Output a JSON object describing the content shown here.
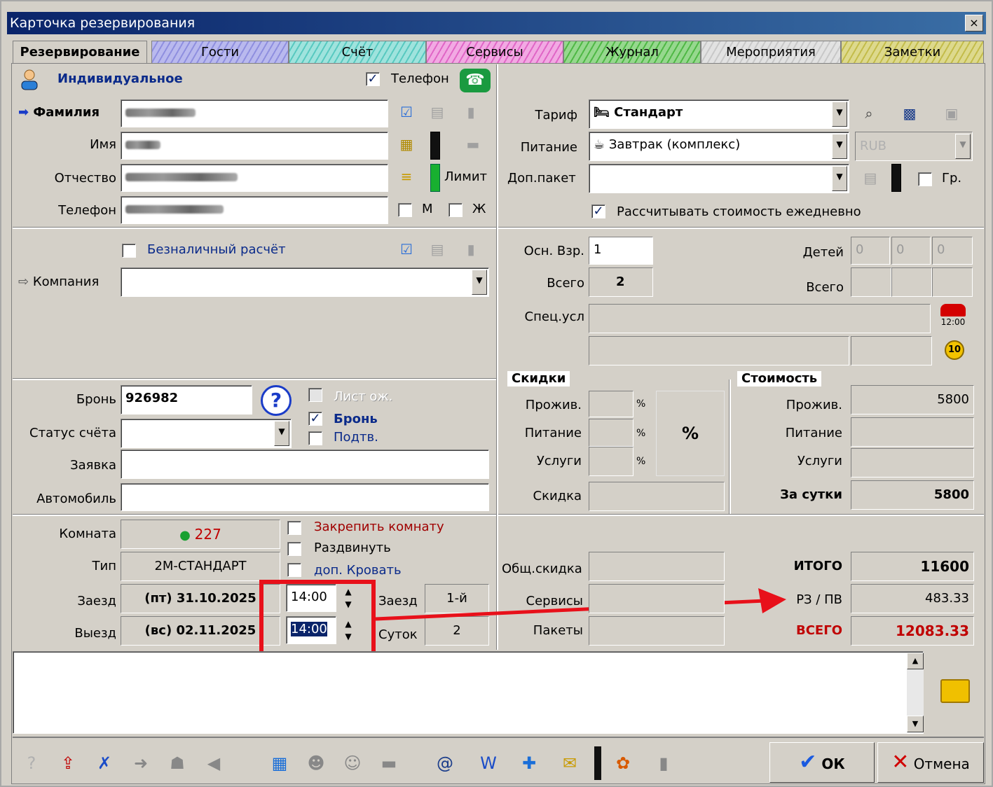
{
  "window": {
    "title": "Карточка резервирования",
    "close": "×"
  },
  "tabs": [
    "Резервирование",
    "Гости",
    "Счёт",
    "Сервисы",
    "Журнал",
    "Мероприятия",
    "Заметки"
  ],
  "guest": {
    "type": "Индивидуальное",
    "phone_label": "Телефон",
    "surname_label": "Фамилия",
    "name_label": "Имя",
    "patronymic_label": "Отчество",
    "phone_field_label": "Телефон",
    "limit_label": "Лимит",
    "m_label": "М",
    "f_label": "Ж"
  },
  "tariff": {
    "tariff_label": "Тариф",
    "tariff_value": "Стандарт",
    "meal_label": "Питание",
    "meal_value": "Завтрак (комплекс)",
    "currency": "RUB",
    "extra_label": "Доп.пакет",
    "group_label": "Гр.",
    "daily_calc": "Рассчитывать стоимость ежедневно"
  },
  "company": {
    "cashless": "Безналичный расчёт",
    "company_label": "Компания"
  },
  "guests_count": {
    "adults_label": "Осн. Взр.",
    "adults_value": "1",
    "children_label": "Детей",
    "child1": "0",
    "child2": "0",
    "child3": "0",
    "total_label": "Всего",
    "total_value": "2",
    "total_label2": "Всего",
    "special_label": "Спец.усл",
    "bus_time": "12:00",
    "coin": "10"
  },
  "booking": {
    "booking_label": "Бронь",
    "booking_number": "926982",
    "waitlist": "Лист ож.",
    "booked": "Бронь",
    "confirmed": "Подтв.",
    "status_label": "Статус счёта",
    "request_label": "Заявка",
    "car_label": "Автомобиль"
  },
  "discounts": {
    "header": "Скидки",
    "living": "Прожив.",
    "meal": "Питание",
    "services": "Услуги",
    "discount": "Скидка",
    "pct": "%",
    "pct_btn": "%"
  },
  "cost": {
    "header": "Стоимость",
    "living": "Прожив.",
    "living_value": "5800",
    "meal": "Питание",
    "services": "Услуги",
    "per_day": "За сутки",
    "per_day_value": "5800"
  },
  "room": {
    "room_label": "Комната",
    "room_value": "227",
    "type_label": "Тип",
    "type_value": "2М-СТАНДАРТ",
    "fix_room": "Закрепить комнату",
    "separate": "Раздвинуть",
    "extra_bed": "доп. Кровать",
    "checkin_label": "Заезд",
    "checkin_date": "(пт) 31.10.2025",
    "checkin_time": "14:00",
    "checkout_label": "Выезд",
    "checkout_date": "(вс) 02.11.2025",
    "checkout_time": "14:00",
    "arrival_label": "Заезд",
    "arrival_value": "1-й",
    "nights_label": "Суток",
    "nights_value": "2"
  },
  "totals": {
    "general_discount": "Общ.скидка",
    "services": "Сервисы",
    "packages": "Пакеты",
    "itogo": "ИТОГО",
    "itogo_value": "11600",
    "rz": "РЗ / ПВ",
    "rz_value": "483.33",
    "vsego": "ВСЕГО",
    "vsego_value": "12083.33"
  },
  "buttons": {
    "ok": "ОК",
    "cancel": "Отмена"
  },
  "colors": {
    "title_bar": "#0a246a",
    "highlight": "#e8101a",
    "red_text": "#c00000"
  }
}
